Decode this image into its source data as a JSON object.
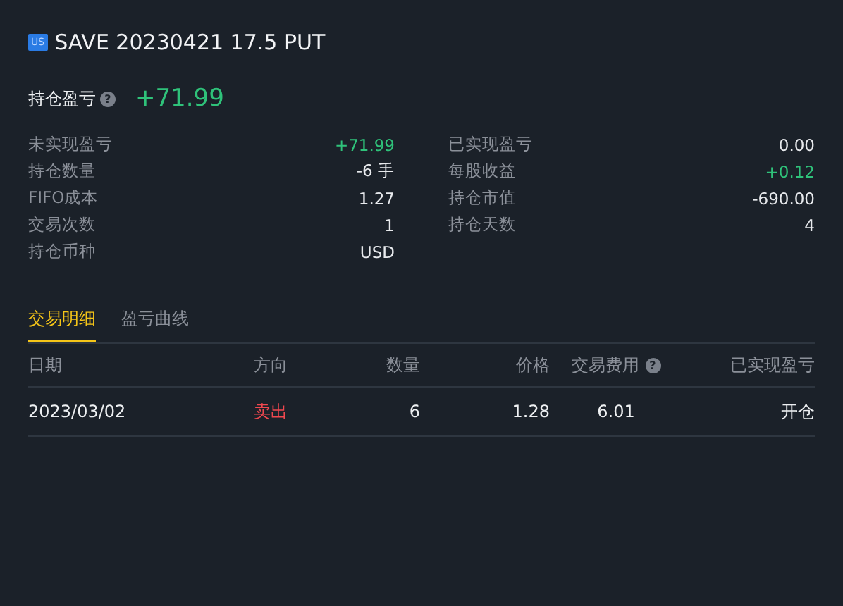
{
  "header": {
    "market_badge": "US",
    "title": "SAVE 20230421 17.5 PUT"
  },
  "position_pnl": {
    "label": "持仓盈亏",
    "value": "+71.99",
    "color": "#2fc27a",
    "help": "?"
  },
  "stats_left": [
    {
      "label": "未实现盈亏",
      "value": "+71.99",
      "color": "#2fc27a"
    },
    {
      "label": "持仓数量",
      "value": "-6 手",
      "color": "#e8eaed"
    },
    {
      "label": "FIFO成本",
      "value": "1.27",
      "color": "#e8eaed"
    },
    {
      "label": "交易次数",
      "value": "1",
      "color": "#e8eaed"
    },
    {
      "label": "持仓币种",
      "value": "USD",
      "color": "#e8eaed"
    }
  ],
  "stats_right": [
    {
      "label": "已实现盈亏",
      "value": "0.00",
      "color": "#e8eaed"
    },
    {
      "label": "每股收益",
      "value": "+0.12",
      "color": "#2fc27a"
    },
    {
      "label": "持仓市值",
      "value": "-690.00",
      "color": "#e8eaed"
    },
    {
      "label": "持仓天数",
      "value": "4",
      "color": "#e8eaed"
    }
  ],
  "tabs": [
    {
      "label": "交易明细",
      "selected": true
    },
    {
      "label": "盈亏曲线",
      "selected": false
    }
  ],
  "table": {
    "columns": [
      {
        "label": "日期"
      },
      {
        "label": "方向"
      },
      {
        "label": "数量"
      },
      {
        "label": "价格"
      },
      {
        "label": "交易费用",
        "help": "?"
      },
      {
        "label": "已实现盈亏"
      }
    ],
    "rows": [
      {
        "cells": [
          "2023/03/02",
          "卖出",
          "6",
          "1.28",
          "6.01",
          "开仓"
        ],
        "kind": "sell"
      }
    ]
  }
}
